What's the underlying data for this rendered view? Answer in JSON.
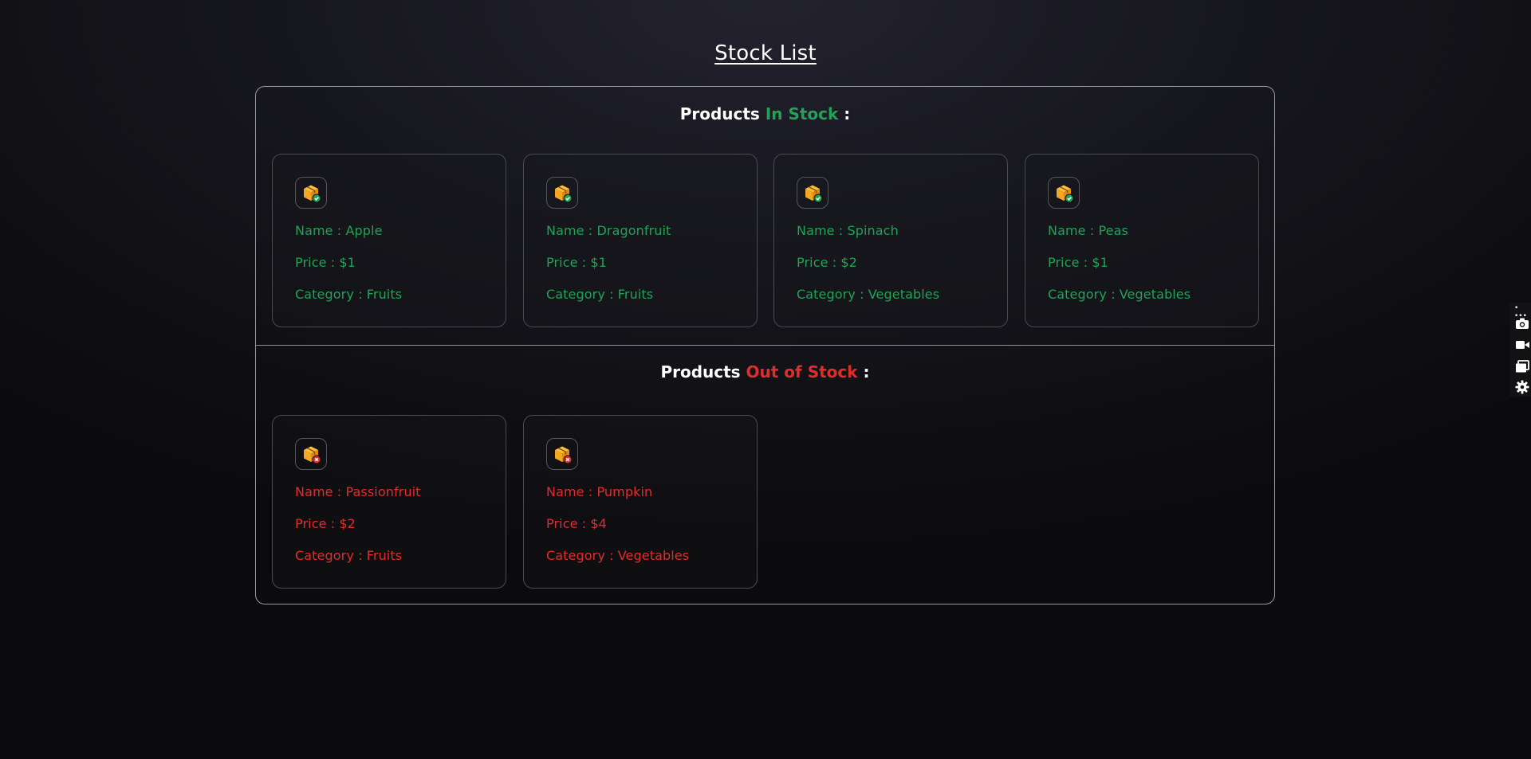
{
  "page": {
    "title": "Stock List"
  },
  "in_stock": {
    "heading_prefix": "Products",
    "heading_highlight": "In Stock",
    "heading_suffix": ":",
    "highlight_color": "#22a256",
    "items": [
      {
        "name": "Name : Apple",
        "price": "Price : $1",
        "category": "Category : Fruits"
      },
      {
        "name": "Name : Dragonfruit",
        "price": "Price : $1",
        "category": "Category : Fruits"
      },
      {
        "name": "Name : Spinach",
        "price": "Price : $2",
        "category": "Category : Vegetables"
      },
      {
        "name": "Name : Peas",
        "price": "Price : $1",
        "category": "Category : Vegetables"
      }
    ]
  },
  "out_of_stock": {
    "heading_prefix": "Products",
    "heading_highlight": "Out of Stock",
    "heading_suffix": ":",
    "highlight_color": "#e12c2c",
    "items": [
      {
        "name": "Name : Passionfruit",
        "price": "Price : $2",
        "category": "Category : Fruits"
      },
      {
        "name": "Name : Pumpkin",
        "price": "Price : $4",
        "category": "Category : Vegetables"
      }
    ]
  },
  "icons": {
    "in_stock_item": "package-check-icon",
    "out_of_stock_item": "package-x-icon",
    "toolbar": [
      "camera-icon",
      "video-camera-icon",
      "windows-icon",
      "gear-icon"
    ]
  },
  "colors": {
    "box": "#f5a623",
    "in_stock": "#22a256",
    "out_of_stock": "#e12c2c"
  },
  "side_toolbar": {
    "label": "• •••"
  }
}
